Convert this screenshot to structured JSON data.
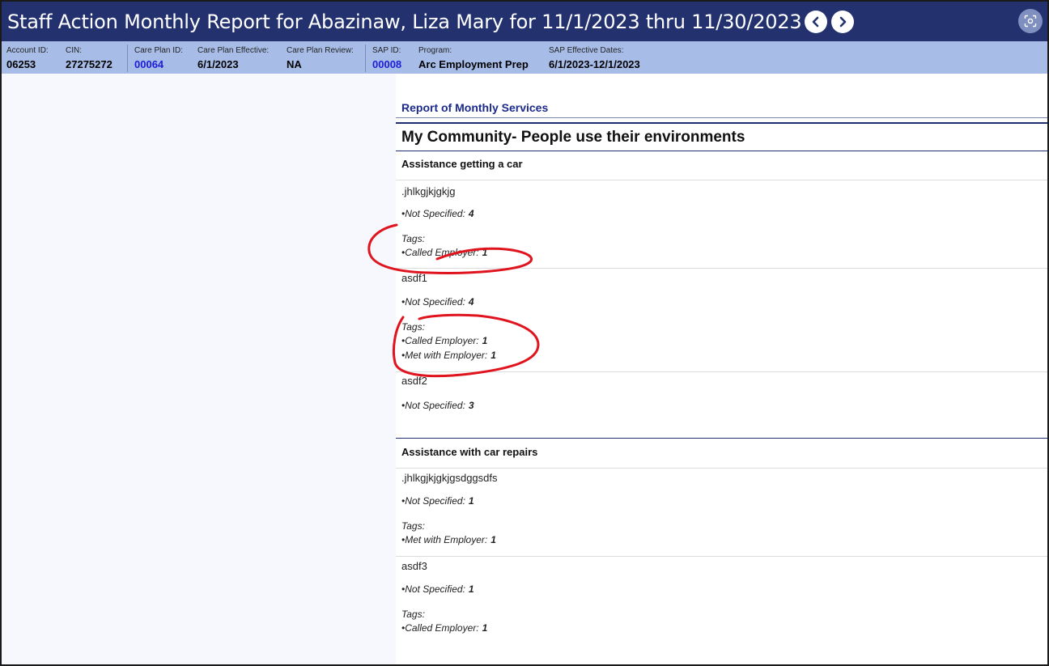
{
  "header": {
    "title": "Staff Action Monthly Report for Abazinaw, Liza Mary for 11/1/2023 thru 11/30/2023",
    "prev_icon": "chevron-left-icon",
    "next_icon": "chevron-right-icon",
    "capture_icon": "screen-capture-icon"
  },
  "info": {
    "account_id": {
      "label": "Account ID:",
      "value": "06253"
    },
    "cin": {
      "label": "CIN:",
      "value": "27275272"
    },
    "care_plan_id": {
      "label": "Care Plan ID:",
      "value": "00064"
    },
    "care_plan_effective": {
      "label": "Care Plan Effective:",
      "value": "6/1/2023"
    },
    "care_plan_review": {
      "label": "Care Plan Review:",
      "value": "NA"
    },
    "sap_id": {
      "label": "SAP ID:",
      "value": "00008"
    },
    "program": {
      "label": "Program:",
      "value": "Arc Employment Prep"
    },
    "sap_dates": {
      "label": "SAP Effective Dates:",
      "value": "6/1/2023-12/1/2023"
    }
  },
  "report": {
    "heading": "Report of Monthly Services",
    "category": "My Community- People use their environments",
    "services": [
      {
        "title": "Assistance getting a car",
        "items": [
          {
            "name": ".jhlkgjkjgkjg",
            "not_specified_label": "•Not Specified:",
            "not_specified": "4",
            "tags_label": "Tags:",
            "tags": [
              {
                "label": "•Called Employer:",
                "count": "1"
              }
            ]
          },
          {
            "name": "asdf1",
            "not_specified_label": "•Not Specified:",
            "not_specified": "4",
            "tags_label": "Tags:",
            "tags": [
              {
                "label": "•Called Employer:",
                "count": "1"
              },
              {
                "label": "•Met with Employer:",
                "count": "1"
              }
            ]
          },
          {
            "name": "asdf2",
            "not_specified_label": "•Not Specified:",
            "not_specified": "3"
          }
        ]
      },
      {
        "title": "Assistance with car repairs",
        "items": [
          {
            "name": ".jhlkgjkjgkjgsdggsdfs",
            "not_specified_label": "•Not Specified:",
            "not_specified": "1",
            "tags_label": "Tags:",
            "tags": [
              {
                "label": "•Met with Employer:",
                "count": "1"
              }
            ]
          },
          {
            "name": "asdf3",
            "not_specified_label": "•Not Specified:",
            "not_specified": "1",
            "tags_label": "Tags:",
            "tags": [
              {
                "label": "•Called Employer:",
                "count": "1"
              }
            ]
          }
        ]
      }
    ]
  },
  "colors": {
    "title_bar": "#23316e",
    "info_bar": "#a7bde8",
    "link": "#1d1dd6",
    "heading": "#1b2a8c",
    "annotation": "#e0141e"
  }
}
